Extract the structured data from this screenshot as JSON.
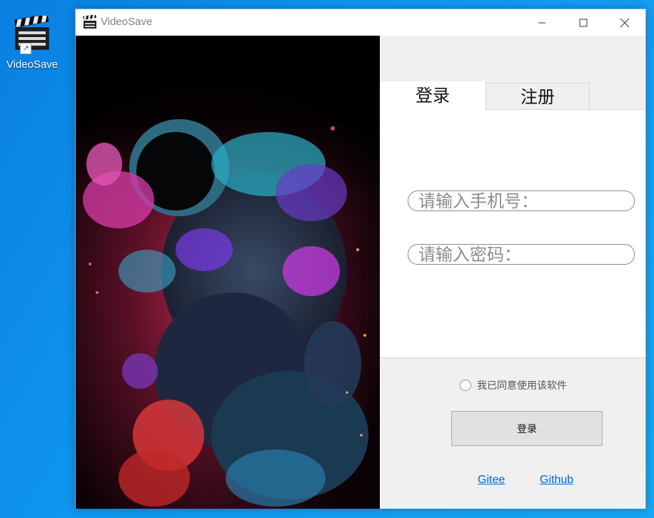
{
  "desktop": {
    "icon_label": "VideoSave",
    "icon_name": "clapperboard-icon"
  },
  "window": {
    "title": "VideoSave",
    "controls": {
      "minimize": "minimize-icon",
      "maximize": "maximize-icon",
      "close": "close-icon"
    }
  },
  "tabs": [
    {
      "label": "登录",
      "active": true
    },
    {
      "label": "注册",
      "active": false
    }
  ],
  "form": {
    "phone_placeholder": "请输入手机号：",
    "password_placeholder": "请输入密码："
  },
  "agree_label": "我已同意使用该软件",
  "login_button": "登录",
  "links": {
    "gitee": "Gitee",
    "github": "Github"
  },
  "colors": {
    "desktop_bg": "#0f97ef",
    "window_bg": "#f0f0f0",
    "link": "#0066cc"
  }
}
